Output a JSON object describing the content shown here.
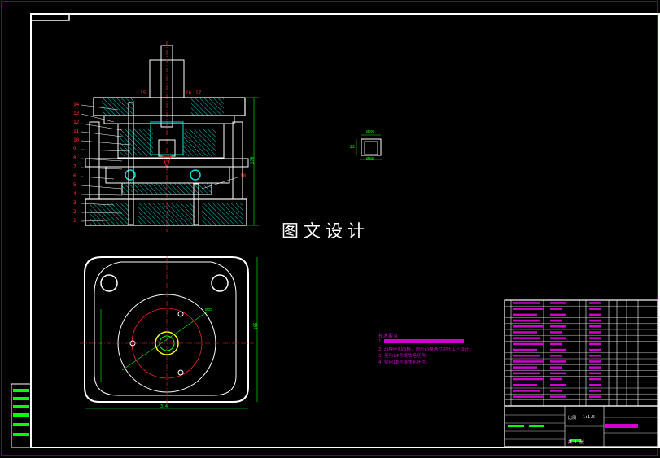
{
  "watermark": "图文设计",
  "part_numbers_left": [
    "14",
    "13",
    "12",
    "11",
    "10",
    "9",
    "8",
    "7",
    "6",
    "5",
    "4",
    "3",
    "2",
    "1"
  ],
  "part_numbers_top": [
    "15",
    "16",
    "17"
  ],
  "part_number_right": "18",
  "dims": {
    "height_label": "170",
    "width_label": "314",
    "dia_label": "Ø85",
    "plan_height": "165",
    "small_w1": "Ø28",
    "small_w2": "Ø38",
    "small_h": "22"
  },
  "tech_requirements": {
    "title": "技术要求",
    "lines": [
      "1.",
      "2. 凸模座和凸模，圆形凸模通过冲压工艺设计。",
      "3. 使用14号铸铁毛坯件。",
      "4. 使用18号铸铁毛坯件。"
    ]
  },
  "title_block": {
    "scale": "比例",
    "scale_value": "1:1.5",
    "sheet": "共 1 张"
  },
  "colors": {
    "frame": "#ffffff",
    "section_fill": "#00e0e0",
    "hatch": "#d000d0",
    "centerline": "#ff2020",
    "dimension": "#00ff00",
    "outline": "#ffffff",
    "yellow": "#ffff00"
  }
}
